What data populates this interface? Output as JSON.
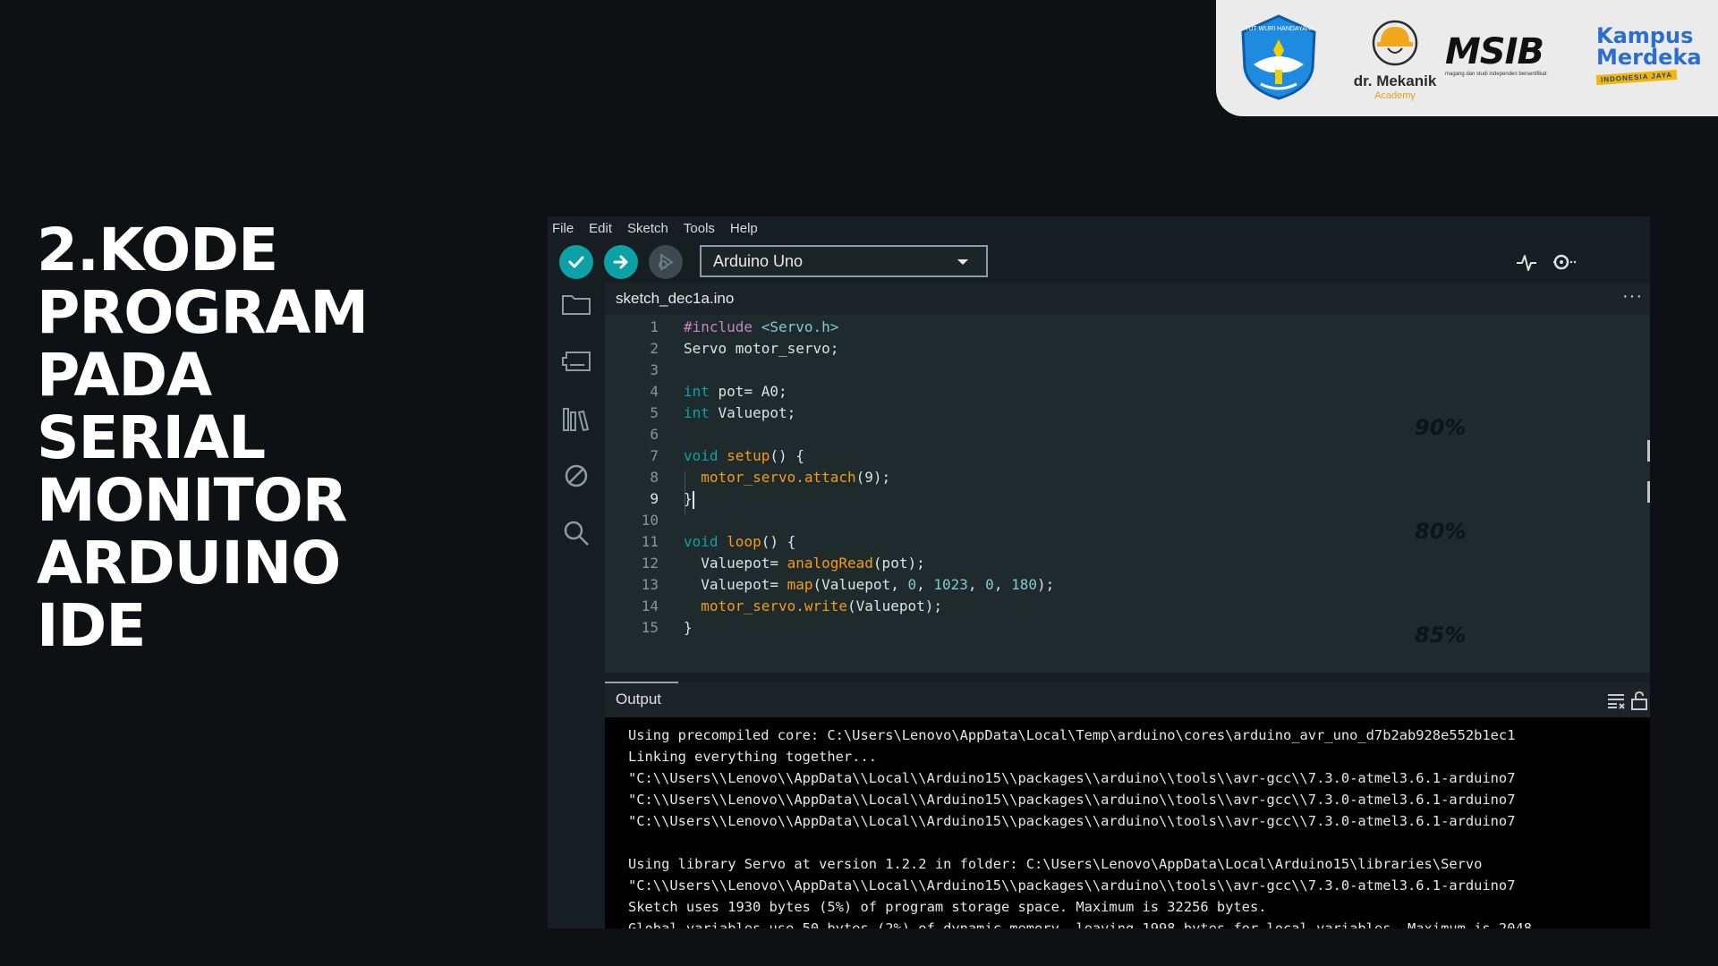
{
  "slide": {
    "title_lines": [
      "2.KODE",
      "PROGRAM",
      "PADA",
      "SERIAL",
      "MONITOR",
      "ARDUINO",
      "IDE"
    ]
  },
  "logos": {
    "mekanik_name": "dr. Mekanik",
    "mekanik_sub": "Academy",
    "msib": "MSIB",
    "msib_tag": "magang dan studi independen bersertifikat",
    "kampus_line1": "Kampus",
    "kampus_line2": "Merdeka",
    "kampus_line3": "INDONESIA JAYA",
    "tut_wuri": "TUT WURI HANDAYANI"
  },
  "menu": [
    "File",
    "Edit",
    "Sketch",
    "Tools",
    "Help"
  ],
  "toolbar": {
    "board_selected": "Arduino Uno",
    "icons": [
      "verify-icon",
      "upload-icon",
      "debug-icon",
      "serial-plotter-icon",
      "serial-monitor-icon"
    ]
  },
  "sidebar": [
    "folder-icon",
    "boards-manager-icon",
    "library-manager-icon",
    "debug-icon",
    "search-icon"
  ],
  "tab": {
    "name": "sketch_dec1a.ino",
    "more": "···"
  },
  "editor": {
    "active_line": 9,
    "lines": [
      {
        "n": "1",
        "tokens": [
          [
            "pp",
            "#include "
          ],
          [
            "inc",
            "<Servo.h>"
          ]
        ]
      },
      {
        "n": "2",
        "tokens": [
          [
            "",
            "Servo motor_servo;"
          ]
        ]
      },
      {
        "n": "3",
        "tokens": []
      },
      {
        "n": "4",
        "tokens": [
          [
            "kw",
            "int"
          ],
          [
            "",
            " pot= A0;"
          ]
        ]
      },
      {
        "n": "5",
        "tokens": [
          [
            "kw",
            "int"
          ],
          [
            "",
            " Valuepot;"
          ]
        ]
      },
      {
        "n": "6",
        "tokens": []
      },
      {
        "n": "7",
        "tokens": [
          [
            "kw",
            "void"
          ],
          [
            "",
            " "
          ],
          [
            "fn",
            "setup"
          ],
          [
            "",
            "() {"
          ]
        ]
      },
      {
        "n": "8",
        "tokens": [
          [
            "",
            "  "
          ],
          [
            "fn",
            "motor_servo.attach"
          ],
          [
            "",
            "(9);"
          ]
        ]
      },
      {
        "n": "9",
        "tokens": [
          [
            "",
            "}"
          ]
        ]
      },
      {
        "n": "10",
        "tokens": []
      },
      {
        "n": "11",
        "tokens": [
          [
            "kw",
            "void"
          ],
          [
            "",
            " "
          ],
          [
            "fn",
            "loop"
          ],
          [
            "",
            "() {"
          ]
        ]
      },
      {
        "n": "12",
        "tokens": [
          [
            "",
            "  Valuepot= "
          ],
          [
            "fn",
            "analogRead"
          ],
          [
            "",
            "(pot);"
          ]
        ]
      },
      {
        "n": "13",
        "tokens": [
          [
            "",
            "  Valuepot= "
          ],
          [
            "fn",
            "map"
          ],
          [
            "",
            "(Valuepot, "
          ],
          [
            "num",
            "0"
          ],
          [
            "",
            ", "
          ],
          [
            "num",
            "1023"
          ],
          [
            "",
            ", "
          ],
          [
            "num",
            "0"
          ],
          [
            "",
            ", "
          ],
          [
            "num",
            "180"
          ],
          [
            "",
            ");"
          ]
        ]
      },
      {
        "n": "14",
        "tokens": [
          [
            "",
            "  "
          ],
          [
            "fn",
            "motor_servo.write"
          ],
          [
            "",
            "(Valuepot);"
          ]
        ]
      },
      {
        "n": "15",
        "tokens": [
          [
            "",
            "}"
          ]
        ]
      }
    ],
    "overlay_percents": [
      "90%",
      "80%",
      "85%"
    ]
  },
  "output": {
    "label": "Output",
    "lines": [
      "Using precompiled core: C:\\Users\\Lenovo\\AppData\\Local\\Temp\\arduino\\cores\\arduino_avr_uno_d7b2ab928e552b1ec1",
      "Linking everything together...",
      "\"C:\\\\Users\\\\Lenovo\\\\AppData\\\\Local\\\\Arduino15\\\\packages\\\\arduino\\\\tools\\\\avr-gcc\\\\7.3.0-atmel3.6.1-arduino7",
      "\"C:\\\\Users\\\\Lenovo\\\\AppData\\\\Local\\\\Arduino15\\\\packages\\\\arduino\\\\tools\\\\avr-gcc\\\\7.3.0-atmel3.6.1-arduino7",
      "\"C:\\\\Users\\\\Lenovo\\\\AppData\\\\Local\\\\Arduino15\\\\packages\\\\arduino\\\\tools\\\\avr-gcc\\\\7.3.0-atmel3.6.1-arduino7",
      "",
      "Using library Servo at version 1.2.2 in folder: C:\\Users\\Lenovo\\AppData\\Local\\Arduino15\\libraries\\Servo",
      "\"C:\\\\Users\\\\Lenovo\\\\AppData\\\\Local\\\\Arduino15\\\\packages\\\\arduino\\\\tools\\\\avr-gcc\\\\7.3.0-atmel3.6.1-arduino7",
      "Sketch uses 1930 bytes (5%) of program storage space. Maximum is 32256 bytes.",
      "Global variables use 50 bytes (2%) of dynamic memory, leaving 1998 bytes for local variables. Maximum is 2048"
    ]
  },
  "colors": {
    "accent": "#0ca1a6",
    "function": "#f39c12",
    "preprocessor": "#c586c0",
    "background": "#0e1014"
  }
}
